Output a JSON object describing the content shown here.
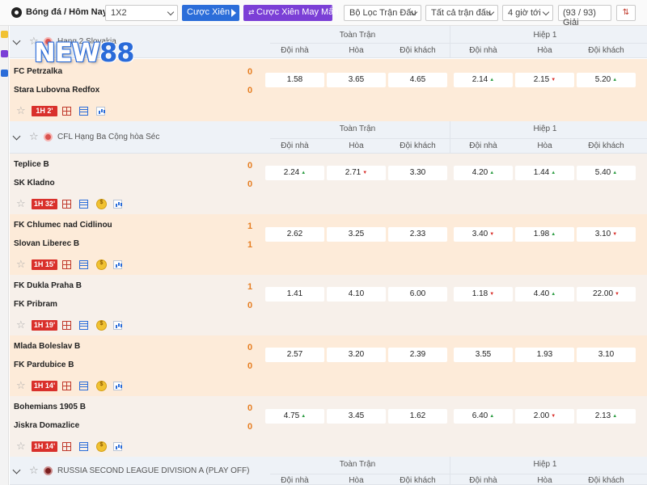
{
  "toolbar": {
    "title": "Bóng đá / Hôm Nay",
    "market_select": "1X2",
    "parlay_button": "Cược Xiên",
    "lucky_parlay_button": "Cược Xiên May Mắn",
    "filter_select": "Bộ Lọc Trận Đấu",
    "all_matches_select": "Tất cả trận đấu",
    "time_select": "4 giờ tới",
    "match_count": "(93 / 93) Giải"
  },
  "logo_text": "NEW",
  "logo_num": "88",
  "column_headers": {
    "full_match": "Toàn Trận",
    "half_1": "Hiệp 1",
    "home": "Đội nhà",
    "draw": "Hòa",
    "away": "Đội khách"
  },
  "leagues": [
    {
      "name": "Hạng 2 Slovakia"
    },
    {
      "name": "CFL Hạng Ba Cộng hòa Séc"
    },
    {
      "name": "RUSSIA SECOND LEAGUE DIVISION A (PLAY OFF)"
    }
  ],
  "matches": [
    {
      "home": "FC Petrzalka",
      "away": "Stara Lubovna Redfox",
      "home_score": "0",
      "away_score": "0",
      "time": "1H 2'",
      "odds": [
        "1.58",
        "3.65",
        "4.65",
        "2.14",
        "2.15",
        "5.20"
      ]
    },
    {
      "home": "Teplice B",
      "away": "SK Kladno",
      "home_score": "0",
      "away_score": "0",
      "time": "1H 32'",
      "odds": [
        "2.24",
        "2.71",
        "3.30",
        "4.20",
        "1.44",
        "5.40"
      ]
    },
    {
      "home": "FK Chlumec nad Cidlinou",
      "away": "Slovan Liberec B",
      "home_score": "1",
      "away_score": "1",
      "time": "1H 15'",
      "odds": [
        "2.62",
        "3.25",
        "2.33",
        "3.40",
        "1.98",
        "3.10"
      ]
    },
    {
      "home": "FK Dukla Praha B",
      "away": "FK Pribram",
      "home_score": "1",
      "away_score": "0",
      "time": "1H 19'",
      "odds": [
        "1.41",
        "4.10",
        "6.00",
        "1.18",
        "4.40",
        "22.00"
      ]
    },
    {
      "home": "Mlada Boleslav B",
      "away": "FK Pardubice B",
      "home_score": "0",
      "away_score": "0",
      "time": "1H 14'",
      "odds": [
        "2.57",
        "3.20",
        "2.39",
        "3.55",
        "1.93",
        "3.10"
      ]
    },
    {
      "home": "Bohemians 1905 B",
      "away": "Jiskra Domazlice",
      "home_score": "0",
      "away_score": "0",
      "time": "1H 14'",
      "odds": [
        "4.75",
        "3.45",
        "1.62",
        "6.40",
        "2.00",
        "2.13"
      ]
    }
  ],
  "coin_symbol": "$",
  "colors": {
    "accent_blue": "#2b6dd9",
    "lucky_purple": "#7b3fd6",
    "live_red": "#d9302b",
    "score_orange": "#e67e22"
  },
  "icons": [
    "soccer-ball-icon",
    "chevron-down-icon",
    "star-icon",
    "grid-icon",
    "document-icon",
    "coin-icon",
    "stats-icon",
    "sort-icon"
  ]
}
